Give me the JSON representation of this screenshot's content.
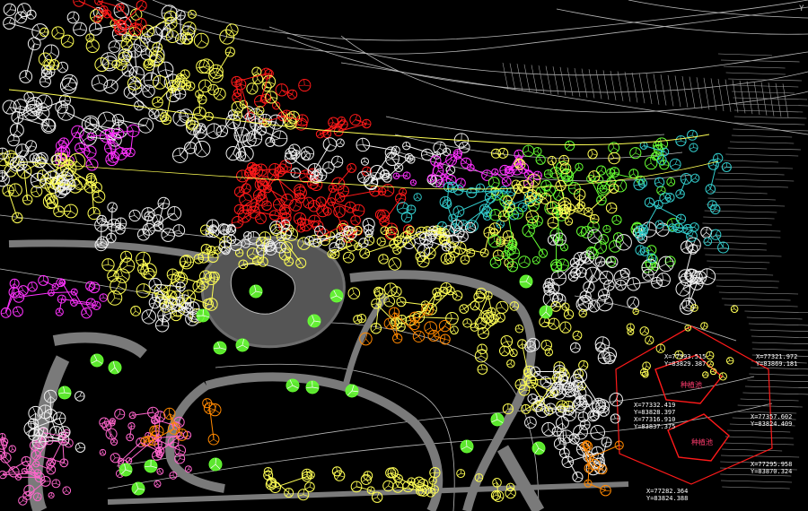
{
  "drawing": {
    "background": "#000000",
    "corner_glyph": "Y",
    "layer_colors": {
      "yellow": "#ffff55",
      "white": "#f0f0f0",
      "green": "#66ff33",
      "cyan": "#33cccc",
      "red": "#ff1a1a",
      "magenta": "#ff33ff",
      "orange": "#ff8800",
      "pink": "#ff66cc",
      "contour": "#b8b8b8",
      "path": "#7a7a7a"
    }
  },
  "coordinates": [
    {
      "x": "X=77393.515",
      "y": "Y=83829.387"
    },
    {
      "x": "X=77332.419",
      "y": "Y=83828.397"
    },
    {
      "x": "X=77316.910",
      "y": "Y=83837.375"
    },
    {
      "x": "X=77321.972",
      "y": "Y=83869.181"
    },
    {
      "x": "X=77357.602",
      "y": "Y=83824.409"
    },
    {
      "x": "X=77295.958",
      "y": "Y=83870.324"
    },
    {
      "x": "X=77282.364",
      "y": "Y=83824.388"
    }
  ],
  "plot_labels": {
    "upper": "种植池",
    "lower": "种植池"
  }
}
